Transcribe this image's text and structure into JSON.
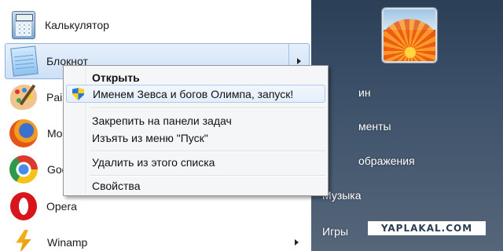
{
  "left_items": [
    {
      "label": "Калькулятор",
      "icon": "calculator-icon"
    },
    {
      "label": "Блокнот",
      "icon": "notepad-icon"
    },
    {
      "label": "Paint",
      "icon": "paint-icon"
    },
    {
      "label": "Mozilla Firefox",
      "icon": "firefox-icon"
    },
    {
      "label": "Google Chrome",
      "icon": "chrome-icon"
    },
    {
      "label": "Opera",
      "icon": "opera-icon"
    },
    {
      "label": "Winamp",
      "icon": "winamp-icon"
    }
  ],
  "left_visible": {
    "paint": "Pair",
    "firefox": "Mo",
    "chrome": "Goo"
  },
  "right_items": {
    "item1": "ин",
    "item2": "менты",
    "item3": "ображения",
    "item4": "Музыка",
    "item5": "Игры"
  },
  "context_menu": {
    "open": "Открыть",
    "run_as": "Именем Зевса и богов Олимпа, запуск!",
    "pin_taskbar": "Закрепить на панели задач",
    "unpin_start": "Изъять из меню \"Пуск\"",
    "remove_list": "Удалить из этого списка",
    "properties": "Свойства"
  },
  "watermark": "YAPLAKAL.COM",
  "colors": {
    "right_panel": "#3b5068",
    "menu_bg": "#f5f6f7",
    "highlight_border": "#aecbee",
    "opera_red": "#d8141c"
  }
}
